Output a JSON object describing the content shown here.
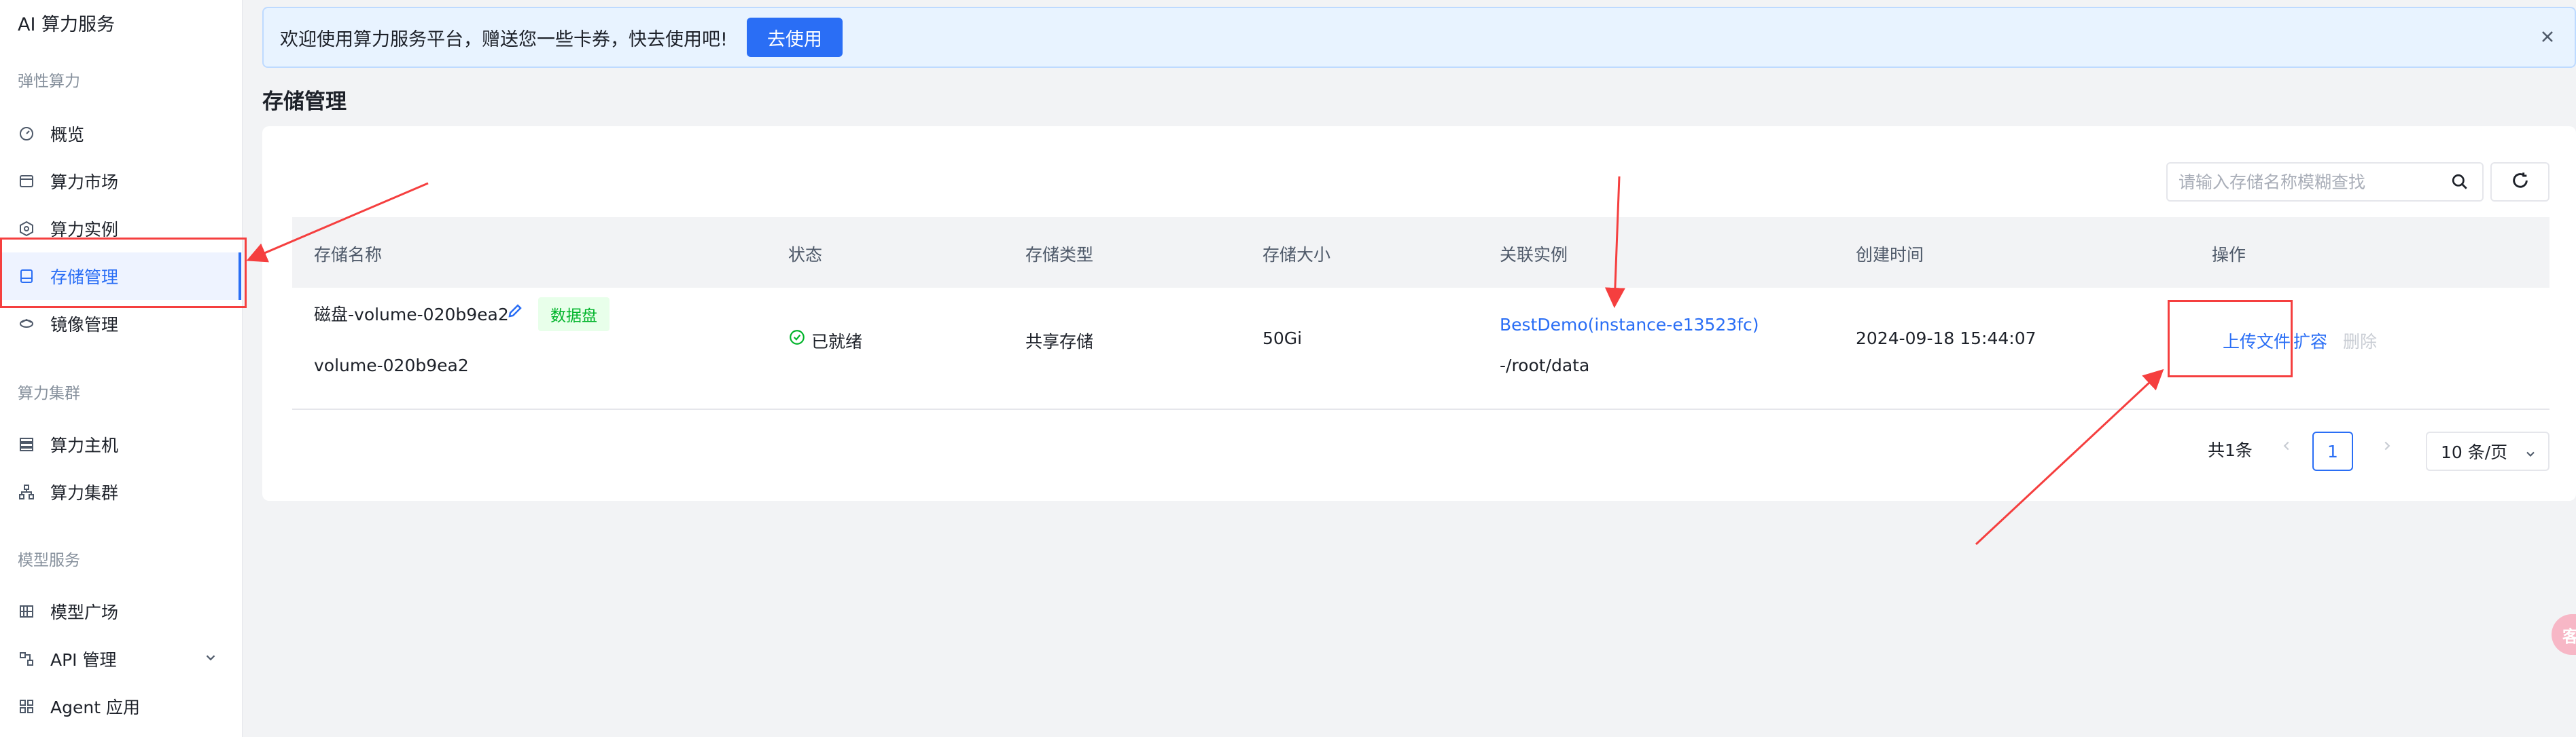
{
  "app": {
    "brand": "AI 算力服务"
  },
  "sidebar": {
    "sections": [
      {
        "title": "弹性算力"
      },
      {
        "title": "算力集群"
      },
      {
        "title": "模型服务"
      }
    ],
    "items": [
      {
        "label": "概览",
        "icon": "gauge-icon"
      },
      {
        "label": "算力市场",
        "icon": "store-icon"
      },
      {
        "label": "算力实例",
        "icon": "instance-icon"
      },
      {
        "label": "存储管理",
        "icon": "storage-icon",
        "active": true
      },
      {
        "label": "镜像管理",
        "icon": "image-icon"
      },
      {
        "label": "算力主机",
        "icon": "server-icon"
      },
      {
        "label": "算力集群",
        "icon": "cluster-icon"
      },
      {
        "label": "模型广场",
        "icon": "model-icon"
      },
      {
        "label": "API 管理",
        "icon": "api-icon"
      },
      {
        "label": "Agent 应用",
        "icon": "apps-icon"
      }
    ]
  },
  "banner": {
    "text": "欢迎使用算力服务平台，赠送您一些卡券，快去使用吧!",
    "button": "去使用"
  },
  "page": {
    "title": "存储管理"
  },
  "search": {
    "placeholder": "请输入存储名称模糊查找"
  },
  "table": {
    "columns": [
      "存储名称",
      "状态",
      "存储类型",
      "存储大小",
      "关联实例",
      "创建时间",
      "操作"
    ],
    "rows": [
      {
        "name": "磁盘-volume-020b9ea2",
        "tag": "数据盘",
        "sub_name": "volume-020b9ea2",
        "status": "已就绪",
        "type": "共享存储",
        "size": "50Gi",
        "instance": "BestDemo(instance-e13523fc)",
        "mount": "-/root/data",
        "created": "2024-09-18 15:44:07",
        "actions": {
          "upload": "上传文件",
          "expand": "扩容",
          "delete": "删除"
        }
      }
    ]
  },
  "pagination": {
    "total": "共1条",
    "page": "1",
    "page_size": "10 条/页"
  },
  "floating": {
    "badge": "客"
  },
  "colors": {
    "accent": "#2a6ef5",
    "success": "#00b42a",
    "annotation": "#f53f3f"
  }
}
